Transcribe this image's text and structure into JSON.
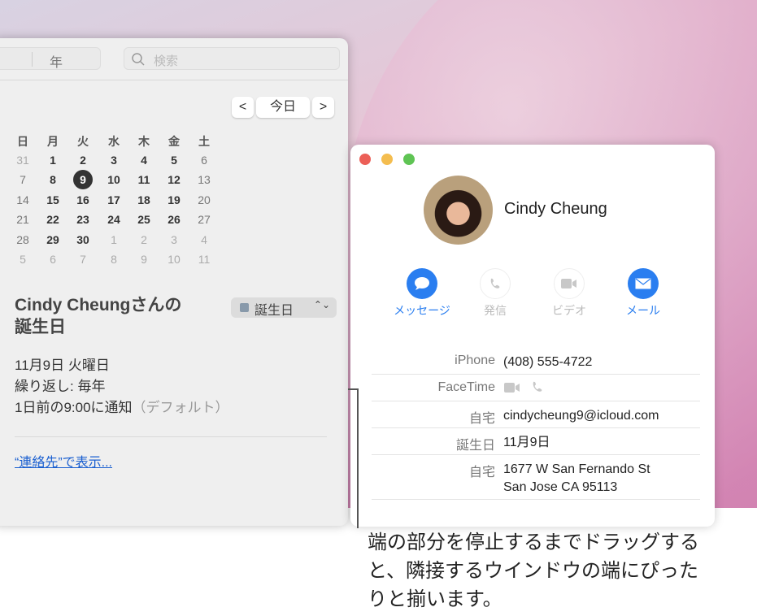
{
  "calendar_window": {
    "toolbar": {
      "year_label": "年",
      "search_placeholder": "検索"
    },
    "nav": {
      "prev": "<",
      "today": "今日",
      "next": ">"
    },
    "weekdays": [
      "日",
      "月",
      "火",
      "水",
      "木",
      "金",
      "土"
    ],
    "weeks": [
      [
        31,
        1,
        2,
        3,
        4,
        5,
        6
      ],
      [
        7,
        8,
        9,
        10,
        11,
        12,
        13
      ],
      [
        14,
        15,
        16,
        17,
        18,
        19,
        20
      ],
      [
        21,
        22,
        23,
        24,
        25,
        26,
        27
      ],
      [
        28,
        29,
        30,
        1,
        2,
        3,
        4
      ],
      [
        5,
        6,
        7,
        8,
        9,
        10,
        11
      ]
    ],
    "selected_day": 9,
    "event": {
      "title": "Cindy Cheungさんの誕生日",
      "calendar": "誕生日",
      "date": "11月9日 火曜日",
      "repeat": "繰り返し: 毎年",
      "alert": "1日前の9:00に通知",
      "alert_note": "（デフォルト）",
      "link": "“連絡先”で表示..."
    }
  },
  "contact_window": {
    "name": "Cindy Cheung",
    "actions": [
      {
        "label": "メッセージ",
        "icon": "message-icon",
        "enabled": true
      },
      {
        "label": "発信",
        "icon": "phone-icon",
        "enabled": false
      },
      {
        "label": "ビデオ",
        "icon": "video-icon",
        "enabled": false
      },
      {
        "label": "メール",
        "icon": "mail-icon",
        "enabled": true
      }
    ],
    "fields": [
      {
        "label": "iPhone",
        "value": "(408) 555-4722"
      },
      {
        "label": "FaceTime",
        "value": ""
      },
      {
        "label": "自宅",
        "value": "cindycheung9@icloud.com"
      },
      {
        "label": "誕生日",
        "value": "11月9日"
      },
      {
        "label": "自宅",
        "value": "1677 W San Fernando St\nSan Jose CA 95113"
      }
    ]
  },
  "caption": "端の部分を停止するまでドラッグすると、隣接するウインドウの端にぴったりと揃います。",
  "colors": {
    "accent": "#2a7ef0",
    "link": "#1a5fd0",
    "close": "#ec5f57",
    "minimize": "#f4bd4f",
    "zoom": "#5fc454"
  }
}
